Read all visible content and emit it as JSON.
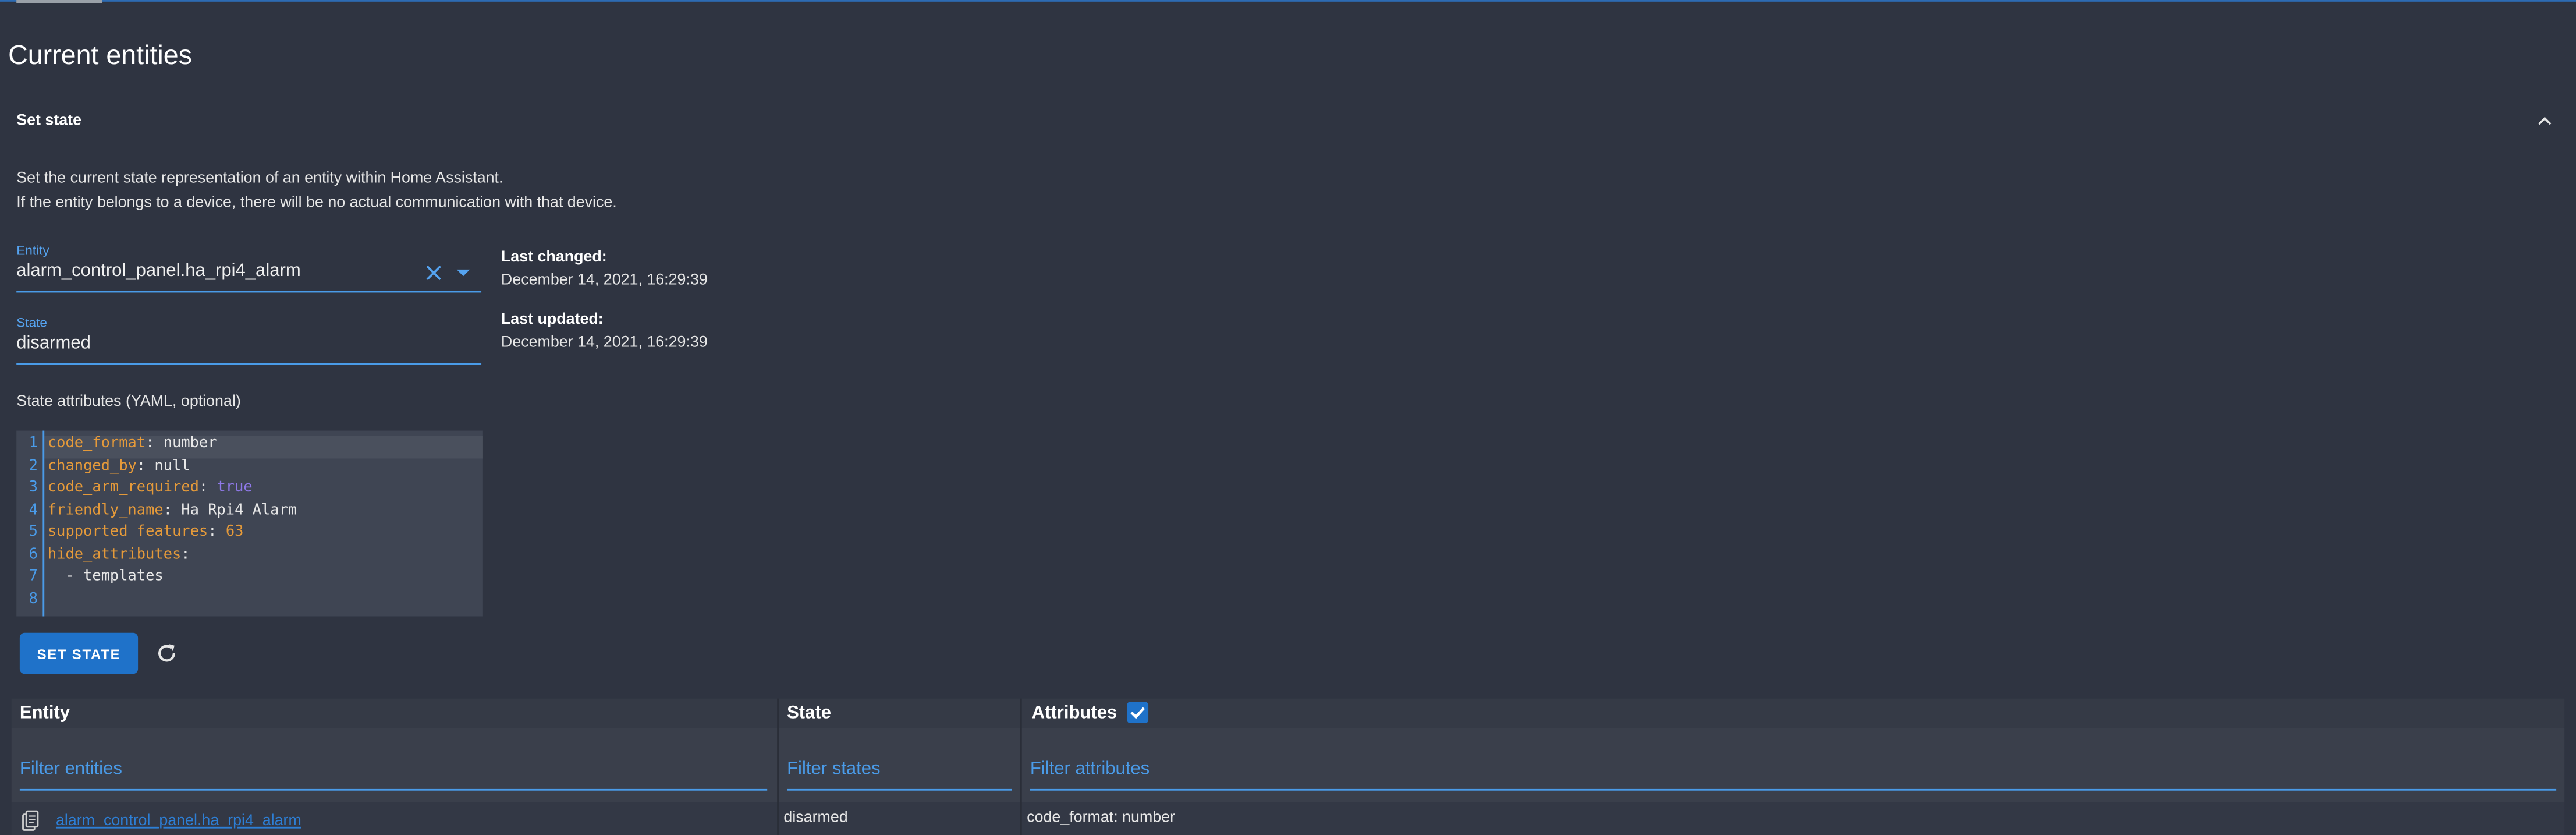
{
  "page": {
    "title": "Current entities"
  },
  "set_state": {
    "section_title": "Set state",
    "description": [
      "Set the current state representation of an entity within Home Assistant.",
      "If the entity belongs to a device, there will be no actual communication with that device."
    ],
    "entity_label": "Entity",
    "entity_value": "alarm_control_panel.ha_rpi4_alarm",
    "state_label": "State",
    "state_value": "disarmed",
    "last_changed_label": "Last changed:",
    "last_changed_value": "December 14, 2021, 16:29:39",
    "last_updated_label": "Last updated:",
    "last_updated_value": "December 14, 2021, 16:29:39",
    "attributes_label": "State attributes (YAML, optional)",
    "yaml_lines": [
      {
        "n": "1",
        "key": "code_format",
        "sep": ": ",
        "val": "number",
        "type": "plain"
      },
      {
        "n": "2",
        "key": "changed_by",
        "sep": ": ",
        "val": "null",
        "type": "plain"
      },
      {
        "n": "3",
        "key": "code_arm_required",
        "sep": ": ",
        "val": "true",
        "type": "bool"
      },
      {
        "n": "4",
        "key": "friendly_name",
        "sep": ": ",
        "val": "Ha Rpi4 Alarm",
        "type": "plain"
      },
      {
        "n": "5",
        "key": "supported_features",
        "sep": ": ",
        "val": "63",
        "type": "num"
      },
      {
        "n": "6",
        "key": "hide_attributes",
        "sep": ":",
        "val": "",
        "type": "plain"
      },
      {
        "n": "7",
        "key": "",
        "sep": "",
        "val": "  - templates",
        "type": "plain"
      },
      {
        "n": "8",
        "key": "",
        "sep": "",
        "val": "",
        "type": "plain"
      }
    ],
    "button_label": "SET STATE"
  },
  "table": {
    "headers": {
      "entity": "Entity",
      "state": "State",
      "attributes": "Attributes"
    },
    "attributes_checked": true,
    "filters": {
      "entity": "Filter entities",
      "state": "Filter states",
      "attributes": "Filter attributes"
    },
    "rows": [
      {
        "entity": "alarm_control_panel.ha_rpi4_alarm",
        "state": "disarmed",
        "attributes": "code_format: number"
      }
    ]
  },
  "colors": {
    "accent": "#1f72c9",
    "background": "#2f3441",
    "link": "#2d7fd6",
    "yaml_key": "#e59a3a",
    "yaml_bool": "#8f79e8"
  },
  "icons": [
    "chevron-up-icon",
    "close-icon",
    "dropdown-caret-icon",
    "refresh-icon",
    "check-icon",
    "clipboard-icon"
  ]
}
